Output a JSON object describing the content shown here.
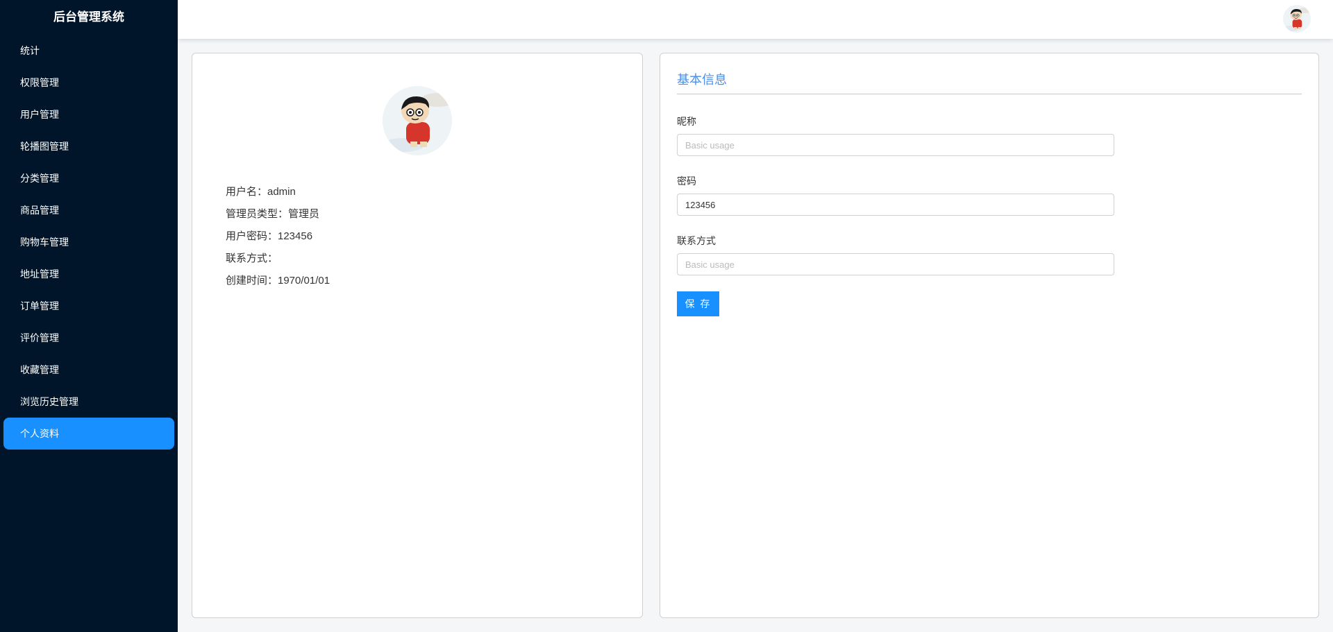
{
  "app": {
    "title": "后台管理系统"
  },
  "sidebar": {
    "items": [
      {
        "label": "统计"
      },
      {
        "label": "权限管理"
      },
      {
        "label": "用户管理"
      },
      {
        "label": "轮播图管理"
      },
      {
        "label": "分类管理"
      },
      {
        "label": "商品管理"
      },
      {
        "label": "购物车管理"
      },
      {
        "label": "地址管理"
      },
      {
        "label": "订单管理"
      },
      {
        "label": "评价管理"
      },
      {
        "label": "收藏管理"
      },
      {
        "label": "浏览历史管理"
      },
      {
        "label": "个人资料"
      }
    ],
    "active_index": 12
  },
  "header": {
    "avatar_icon": "cartoon-avatar"
  },
  "profile": {
    "username": "用户名：admin",
    "admin_type": "管理员类型：管理员",
    "password": "用户密码：123456",
    "contact": "联系方式：",
    "created": "创建时间：1970/01/01"
  },
  "form": {
    "title": "基本信息",
    "nickname_label": "昵称",
    "nickname_placeholder": "Basic usage",
    "nickname_value": "",
    "password_label": "密码",
    "password_value": "123456",
    "contact_label": "联系方式",
    "contact_placeholder": "Basic usage",
    "contact_value": "",
    "save_label": "保 存"
  },
  "colors": {
    "sidebar_bg": "#001529",
    "accent": "#1890ff",
    "title_blue": "#4a8ee8"
  }
}
